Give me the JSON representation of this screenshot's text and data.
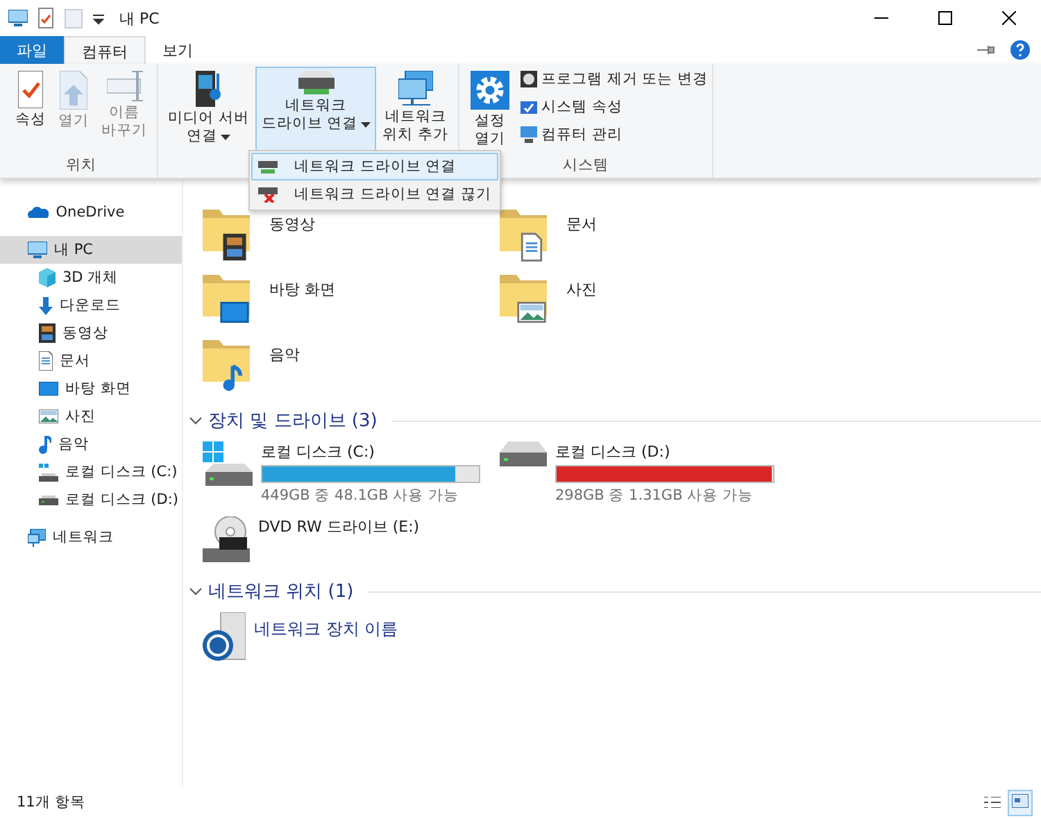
{
  "window": {
    "title": "내 PC"
  },
  "ribbon": {
    "tabs": [
      {
        "label": "파일",
        "kind": "file",
        "selected": false
      },
      {
        "label": "컴퓨터",
        "kind": "tab",
        "selected": true
      },
      {
        "label": "보기",
        "kind": "tab",
        "selected": false
      }
    ],
    "groups": [
      {
        "label": "위치",
        "buttons": [
          {
            "lines": [
              "속성"
            ],
            "disabled": false,
            "pressed": false,
            "menu": false
          },
          {
            "lines": [
              "열기"
            ],
            "disabled": true,
            "pressed": false,
            "menu": false
          },
          {
            "lines": [
              "이름",
              "바꾸기"
            ],
            "disabled": true,
            "pressed": false,
            "menu": false
          }
        ]
      },
      {
        "buttons": [
          {
            "lines": [
              "미디어 서버",
              "연결"
            ],
            "disabled": false,
            "pressed": false,
            "menu": true
          },
          {
            "lines": [
              "네트워크",
              "드라이브 연결"
            ],
            "disabled": false,
            "pressed": true,
            "menu": true
          },
          {
            "lines": [
              "네트워크",
              "위치 추가"
            ],
            "disabled": false,
            "pressed": false,
            "menu": false
          }
        ]
      },
      {
        "label": "시스템",
        "buttons": [
          {
            "lines": [
              "설정",
              "열기"
            ],
            "disabled": false,
            "pressed": false,
            "menu": false
          }
        ],
        "small_buttons": [
          {
            "label": "프로그램 제거 또는 변경"
          },
          {
            "label": "시스템 속성"
          },
          {
            "label": "컴퓨터 관리"
          }
        ]
      }
    ]
  },
  "dropdown_menu": [
    {
      "label": "네트워크 드라이브 연결",
      "selected": true
    },
    {
      "label": "네트워크 드라이브 연결 끊기",
      "selected": false
    }
  ],
  "sidebar": {
    "items": [
      {
        "label": "OneDrive",
        "selected": false
      },
      {
        "label": "내 PC",
        "selected": true,
        "children": [
          {
            "label": "3D 개체",
            "selected": false
          },
          {
            "label": "다운로드",
            "selected": false
          },
          {
            "label": "동영상",
            "selected": false
          },
          {
            "label": "문서",
            "selected": false
          },
          {
            "label": "바탕 화면",
            "selected": false
          },
          {
            "label": "사진",
            "selected": false
          },
          {
            "label": "음악",
            "selected": false
          },
          {
            "label": "로컬 디스크 (C:)",
            "selected": false
          },
          {
            "label": "로컬 디스크 (D:)",
            "selected": false
          }
        ]
      },
      {
        "label": "네트워크",
        "selected": false
      }
    ]
  },
  "folders": [
    {
      "label": "동영상"
    },
    {
      "label": "문서"
    },
    {
      "label": "바탕 화면"
    },
    {
      "label": "사진"
    },
    {
      "label": "음악"
    }
  ],
  "sections": [
    {
      "title": "장치 및 드라이브 (3)",
      "expanded": true,
      "items": [
        {
          "kind": "drive",
          "label": "로컬 디스크 (C:)",
          "level": 0.893,
          "reading": "449GB 중 48.1GB 사용 가능"
        },
        {
          "kind": "drive",
          "label": "로컬 디스크 (D:)",
          "level": 0.996,
          "reading": "298GB 중 1.31GB 사용 가능"
        },
        {
          "kind": "optical",
          "label": "DVD RW 드라이브 (E:)"
        }
      ]
    },
    {
      "title": "네트워크 위치 (1)",
      "expanded": true,
      "items": [
        {
          "kind": "netdevice",
          "label": "네트워크 장치 이름"
        }
      ]
    }
  ],
  "status_bar": {
    "text": "11개 항목",
    "views": [
      {
        "selected": false
      },
      {
        "selected": true
      }
    ]
  }
}
